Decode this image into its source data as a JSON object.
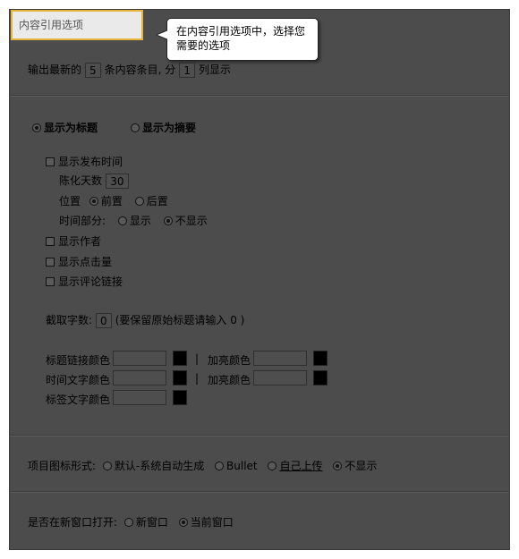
{
  "tab": {
    "label": "内容引用选项"
  },
  "callout": {
    "line1": "在内容引用选项中，选择您",
    "line2": "需要的选项"
  },
  "output": {
    "prefix": "输出最新的",
    "count": "5",
    "middle": "条内容条目, 分",
    "columns": "1",
    "suffix": "列显示"
  },
  "display_mode": {
    "title_label": "显示为标题",
    "summary_label": "显示为摘要",
    "selected": "title"
  },
  "publish_time": {
    "label": "显示发布时间",
    "days_label": "陈化天数",
    "days_value": "30",
    "position_label": "位置",
    "position_options": [
      "前置",
      "后置"
    ],
    "position_selected": "前置",
    "time_part_label": "时间部分:",
    "time_part_options": [
      "显示",
      "不显示"
    ],
    "time_part_selected": "不显示"
  },
  "checkboxes": {
    "author": "显示作者",
    "clicks": "显示点击量",
    "comments": "显示评论链接"
  },
  "truncate": {
    "label": "截取字数:",
    "value": "0",
    "hint": "(要保留原始标题请输入 0 )"
  },
  "colors": {
    "title_link": "标题链接颜色",
    "highlight": "加亮颜色",
    "time_text": "时间文字颜色",
    "tag_text": "标签文字颜色",
    "separator": "|",
    "swatch_color": "#000000",
    "panel_bg": "#4c4c4c",
    "accent": "#e8b43a"
  },
  "icon_style": {
    "label": "项目图标形式:",
    "options": [
      "默认-系统自动生成",
      "Bullet",
      "自己上传",
      "不显示"
    ],
    "selected": "不显示"
  },
  "new_window": {
    "label": "是否在新窗口打开:",
    "options": [
      "新窗口",
      "当前窗口"
    ],
    "selected": "当前窗口"
  }
}
